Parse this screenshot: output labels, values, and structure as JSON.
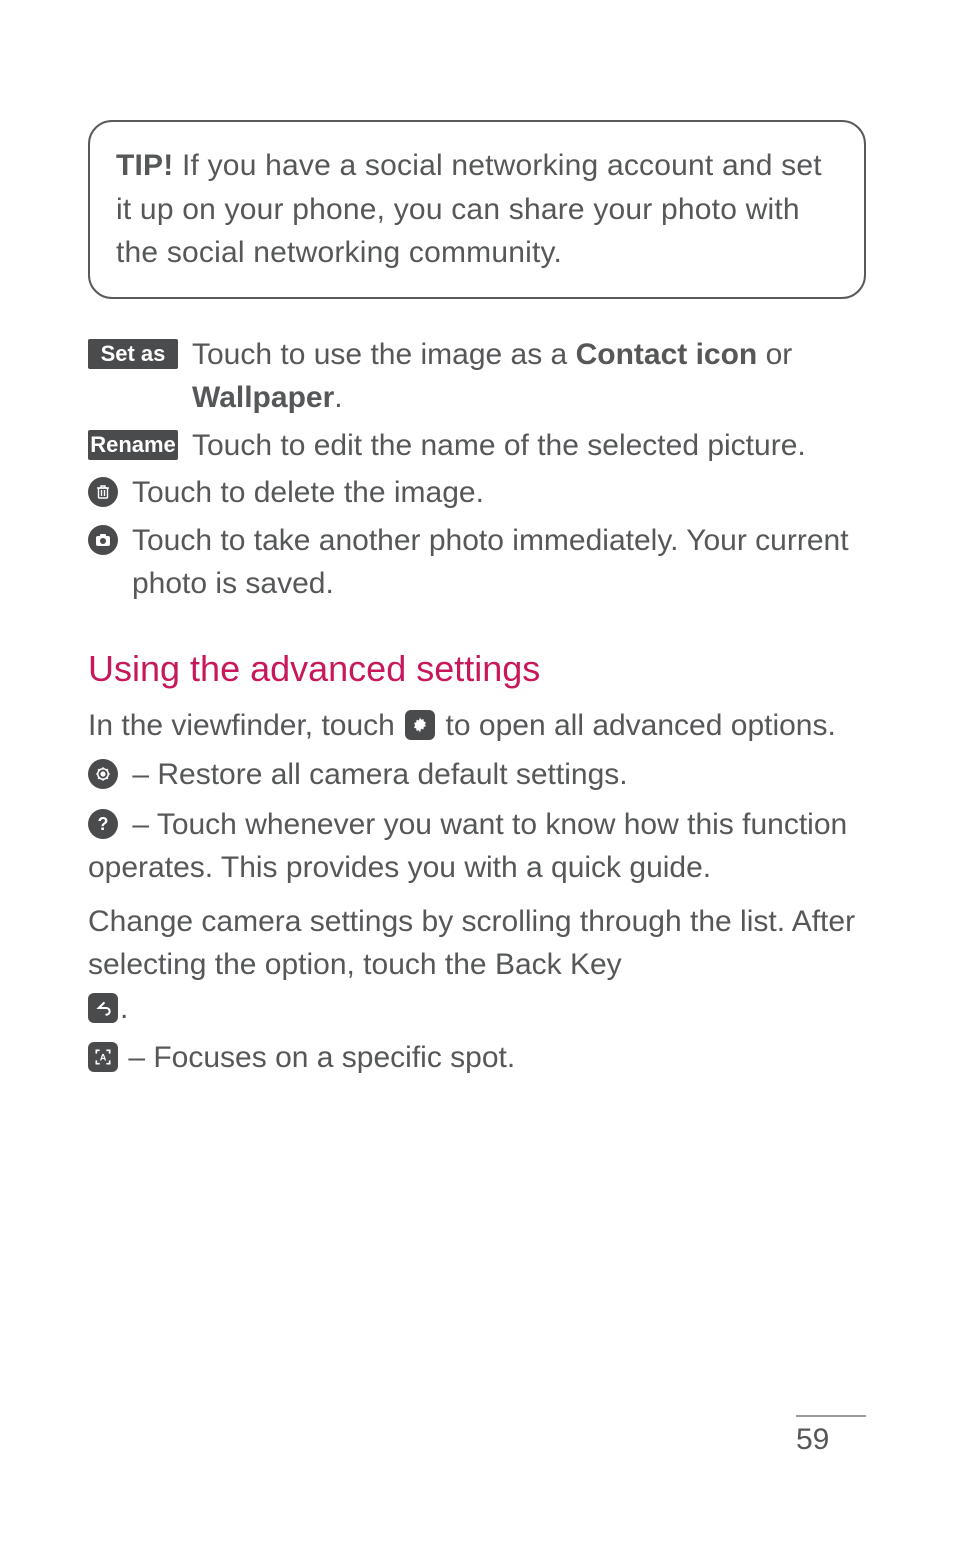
{
  "tip": {
    "label": "TIP!",
    "text": " If you have a social networking account and set it up on your phone, you can share your photo with the social networking community."
  },
  "rows": {
    "setas": {
      "badge": "Set as",
      "text_pre": "Touch to use the image as a ",
      "bold1": "Contact icon",
      "text_mid": " or ",
      "bold2": "Wallpaper",
      "text_post": "."
    },
    "rename": {
      "badge": "Rename",
      "text": "Touch to edit the name of the selected picture."
    },
    "delete": {
      "text": "Touch to delete the image."
    },
    "camera": {
      "text": "Touch to take another photo immediately. Your current photo is saved."
    }
  },
  "section": {
    "title": "Using the advanced settings",
    "intro_pre": "In the viewfinder, touch ",
    "intro_post": " to open all advanced options.",
    "restore": " – Restore all camera default settings.",
    "help": " – Touch whenever you want to know how this function operates. This provides you with a quick guide.",
    "scroll_pre": "Change camera settings by scrolling through the list. After selecting the option, touch the ",
    "scroll_bold": "Back Key",
    "scroll_post": ".",
    "focus": " – Focuses on a specific spot."
  },
  "page_number": "59"
}
